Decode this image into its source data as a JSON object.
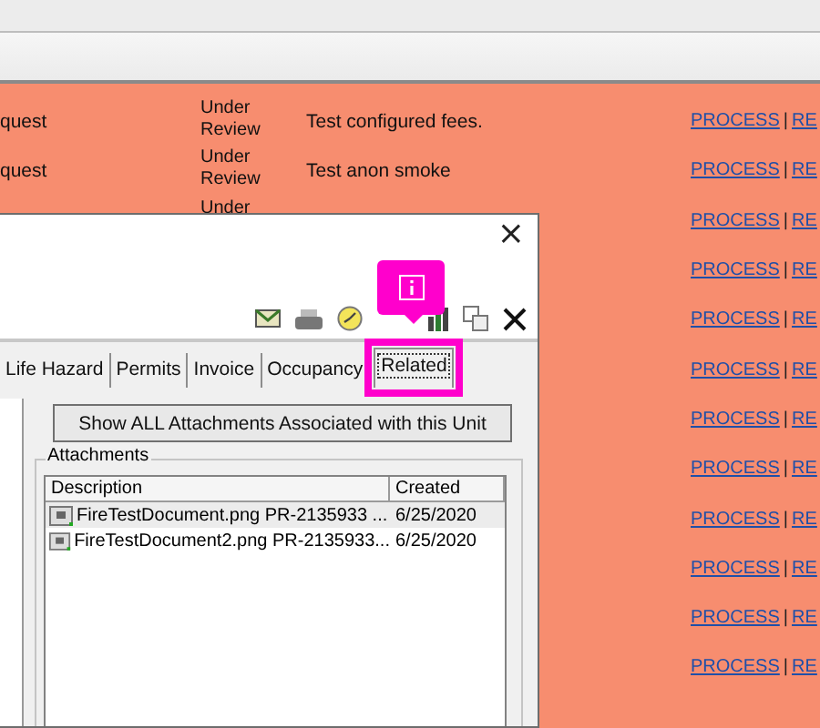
{
  "background_table": {
    "rows": [
      {
        "column_1": "quest",
        "status": "Under Review",
        "description": "Test configured fees.",
        "actions": {
          "links": [
            "PROCESS",
            "RE"
          ],
          "separator": "|"
        }
      },
      {
        "column_1": "quest",
        "status": "Under Review",
        "description": "Test anon smoke",
        "actions": {
          "links": [
            "PROCESS",
            "RE"
          ],
          "separator": "|"
        }
      },
      {
        "status": "Under",
        "actions": {
          "links": [
            "PROCESS",
            "RE"
          ],
          "separator": "|"
        }
      },
      {
        "actions": {
          "links": [
            "PROCESS",
            "RE"
          ],
          "separator": "|"
        }
      },
      {
        "actions": {
          "links": [
            "PROCESS",
            "RE"
          ],
          "separator": "|"
        }
      },
      {
        "actions": {
          "links": [
            "PROCESS",
            "RE"
          ],
          "separator": "|"
        }
      },
      {
        "actions": {
          "links": [
            "PROCESS",
            "RE"
          ],
          "separator": "|"
        }
      },
      {
        "actions": {
          "links": [
            "PROCESS",
            "RE"
          ],
          "separator": "|"
        }
      },
      {
        "actions": {
          "links": [
            "PROCESS",
            "RE"
          ],
          "separator": "|"
        }
      },
      {
        "actions": {
          "links": [
            "PROCESS",
            "RE"
          ],
          "separator": "|"
        }
      },
      {
        "actions": {
          "links": [
            "PROCESS",
            "RE"
          ],
          "separator": "|"
        }
      },
      {
        "actions": {
          "links": [
            "PROCESS",
            "RE"
          ],
          "separator": "|"
        }
      }
    ]
  },
  "dialog": {
    "close": "×",
    "tabs": [
      {
        "label": "Life Hazard",
        "selected": false,
        "highlighted": false
      },
      {
        "label": "Permits",
        "selected": false,
        "highlighted": false
      },
      {
        "label": "Invoice",
        "selected": false,
        "highlighted": false
      },
      {
        "label": "Occupancy",
        "selected": false,
        "highlighted": false
      },
      {
        "label": "Related",
        "selected": true,
        "highlighted": true
      }
    ],
    "callout": {
      "kind": "info"
    },
    "show_all_button": "Show ALL Attachments Associated with this Unit",
    "attachments": {
      "title": "Attachments",
      "columns": [
        "Description",
        "Created"
      ],
      "rows": [
        {
          "description": "FireTestDocument.png PR-2135933 ...",
          "created": "6/25/2020",
          "selected": true
        },
        {
          "description": "FireTestDocument2.png PR-2135933...",
          "created": "6/25/2020",
          "selected": false
        }
      ]
    }
  }
}
